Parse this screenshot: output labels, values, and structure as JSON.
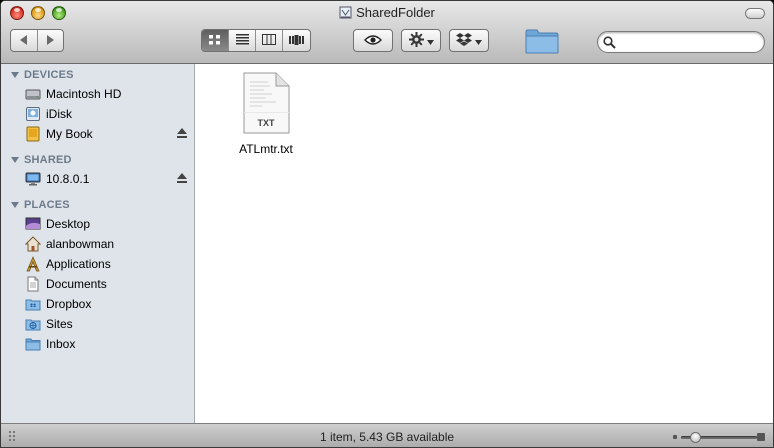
{
  "window": {
    "title": "SharedFolder"
  },
  "toolbar": {
    "nav": [
      {
        "icon": "back-arrow-icon"
      },
      {
        "icon": "forward-arrow-icon"
      }
    ],
    "view_modes": [
      {
        "name": "icon-view",
        "icon": "grid-icon",
        "active": true
      },
      {
        "name": "list-view",
        "icon": "list-icon",
        "active": false
      },
      {
        "name": "column-view",
        "icon": "columns-icon",
        "active": false
      },
      {
        "name": "cover-flow-view",
        "icon": "coverflow-icon",
        "active": false
      }
    ],
    "quick_look_icon": "eye-icon",
    "action_icon": "gear-icon",
    "dropbox_icon": "dropbox-icon",
    "folder_icon": "folder-icon",
    "search": {
      "value": "",
      "placeholder": ""
    }
  },
  "sidebar": {
    "sections": [
      {
        "heading": "DEVICES",
        "items": [
          {
            "label": "Macintosh HD",
            "icon": "hard-drive-icon",
            "eject": false
          },
          {
            "label": "iDisk",
            "icon": "idisk-icon",
            "eject": false
          },
          {
            "label": "My Book",
            "icon": "external-drive-icon",
            "eject": true
          }
        ]
      },
      {
        "heading": "SHARED",
        "items": [
          {
            "label": "10.8.0.1",
            "icon": "network-computer-icon",
            "eject": true
          }
        ]
      },
      {
        "heading": "PLACES",
        "items": [
          {
            "label": "Desktop",
            "icon": "desktop-icon",
            "eject": false
          },
          {
            "label": "alanbowman",
            "icon": "home-icon",
            "eject": false
          },
          {
            "label": "Applications",
            "icon": "applications-icon",
            "eject": false
          },
          {
            "label": "Documents",
            "icon": "documents-icon",
            "eject": false
          },
          {
            "label": "Dropbox",
            "icon": "dropbox-folder-icon",
            "eject": false
          },
          {
            "label": "Sites",
            "icon": "sites-icon",
            "eject": false
          },
          {
            "label": "Inbox",
            "icon": "folder-icon",
            "eject": false
          }
        ]
      }
    ]
  },
  "content": {
    "files": [
      {
        "name": "ATLmtr.txt",
        "type_badge": "TXT",
        "icon": "text-document-icon"
      }
    ]
  },
  "status": {
    "text": "1 item, 5.43 GB available"
  },
  "icon_size_slider": {
    "value_fraction": 0.2
  },
  "colors": {
    "sidebar_bg": "#dfe4ea",
    "sidebar_heading": "#6d7a8a",
    "close": "#d42a1a",
    "minimize": "#d8940c",
    "zoom": "#3f9a1a"
  }
}
